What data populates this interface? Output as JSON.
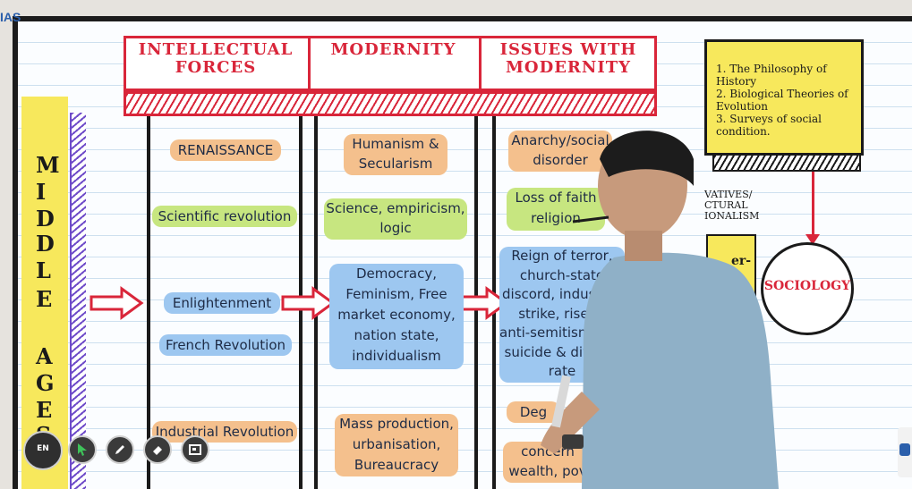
{
  "logo": {
    "text": "IAS"
  },
  "headers": {
    "col1": [
      "INTELLECTUAL",
      "FORCES"
    ],
    "col2": [
      "MODERNITY"
    ],
    "col3": [
      "ISSUES WITH",
      "MODERNITY"
    ]
  },
  "middle_ages": [
    "M",
    "I",
    "D",
    "D",
    "L",
    "E",
    "A",
    "G",
    "E",
    "S"
  ],
  "col1": {
    "renaissance": "RENAISSANCE",
    "scientific": "Scientific revolution",
    "enlightenment": "Enlightenment",
    "french": "French Revolution",
    "industrial": "Industrial Revolution"
  },
  "col2": {
    "humanism": [
      "Humanism &",
      "Secularism"
    ],
    "science": [
      "Science, empiricism,",
      "logic"
    ],
    "democracy": [
      "Democracy,",
      "Feminism, Free",
      "market economy,",
      "nation state,",
      "individualism"
    ],
    "mass": [
      "Mass production,",
      "urbanisation,",
      "Bureaucracy"
    ]
  },
  "col3": {
    "anarchy": [
      "Anarchy/social",
      "disorder"
    ],
    "loss": [
      "Loss of faith",
      "religion"
    ],
    "reign": [
      "Reign of terror,",
      "church-state",
      "discord, industrial",
      "strike, rise of",
      "anti-semitism, high",
      "suicide & divorce",
      "rate"
    ],
    "deg": "Deg",
    "concern": [
      "concern",
      "wealth, pov"
    ]
  },
  "right_box": {
    "items": [
      "1.  The Philosophy of History",
      "2.  Biological Theories of Evolution",
      "3.  Surveys of social condition."
    ]
  },
  "partial": [
    "VATIVES/",
    "CTURAL",
    "IONALISM"
  ],
  "partial_box": "er-",
  "sociology": "SOCIOLOGY",
  "toolbar": {
    "language": "EN"
  },
  "colors": {
    "red": "#d9263a",
    "orange": "#f4c08d",
    "green": "#c7e680",
    "blue": "#9dc7f0",
    "yellow": "#f7e85c",
    "purple": "#6f4cc9"
  }
}
